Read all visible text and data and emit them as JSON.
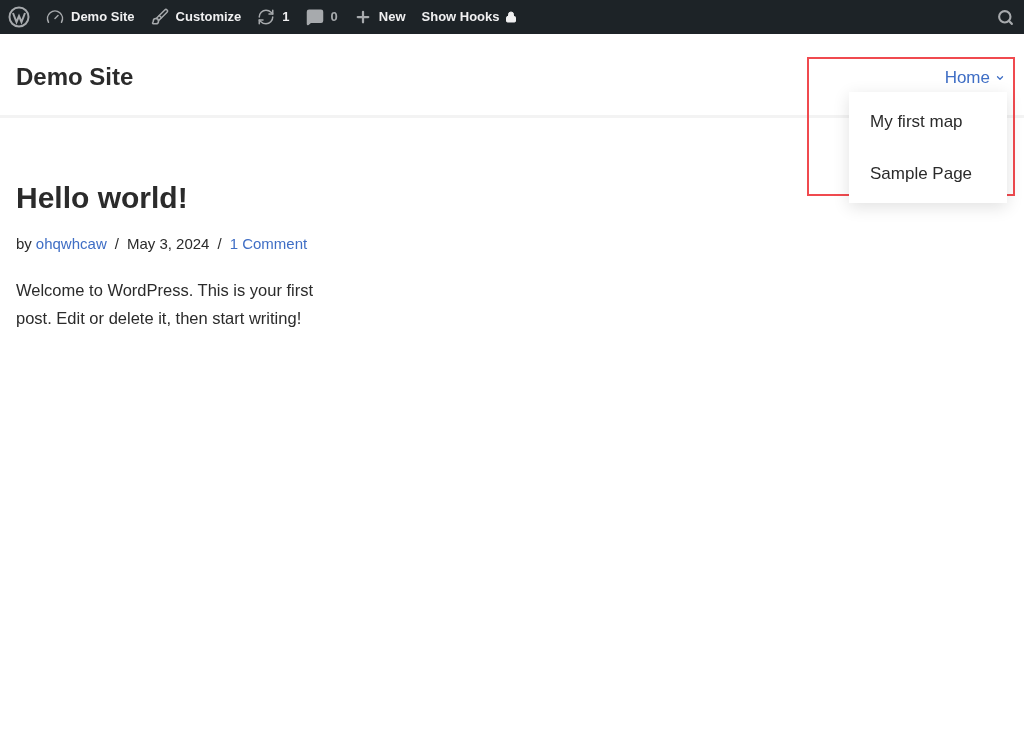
{
  "admin_bar": {
    "items": [
      {
        "kind": "site",
        "label": "Demo Site"
      },
      {
        "kind": "customize",
        "label": "Customize"
      },
      {
        "kind": "updates",
        "label": "1"
      },
      {
        "kind": "comments",
        "label": "0"
      },
      {
        "kind": "new",
        "label": "New"
      },
      {
        "kind": "hooks",
        "label": "Show Hooks"
      }
    ]
  },
  "header": {
    "site_title": "Demo Site",
    "nav": {
      "label": "Home",
      "expanded": true,
      "submenu": [
        "My first map",
        "Sample Page"
      ]
    }
  },
  "post": {
    "title": "Hello world!",
    "by": "by",
    "author": "ohqwhcaw",
    "separator_1": "/",
    "date": "May 3, 2024",
    "separator_2": "/",
    "comments": "1 Comment",
    "body": "Welcome to WordPress. This is your first post. Edit or delete it, then start writing!"
  }
}
